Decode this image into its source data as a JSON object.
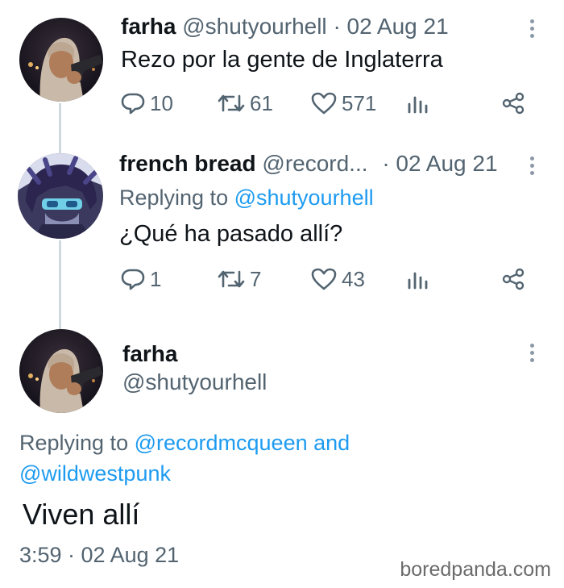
{
  "tweet1": {
    "name": "farha",
    "handle": "@shutyourhell",
    "sep": "·",
    "date": "02 Aug 21",
    "text": "Rezo por la gente de Inglaterra",
    "replies": "10",
    "retweets": "61",
    "likes": "571"
  },
  "tweet2": {
    "name": "french bread",
    "handle": "@record...",
    "sep": "·",
    "date": "02 Aug 21",
    "replying_prefix": "Replying to ",
    "replying_to": "@shutyourhell",
    "text": "¿Qué ha pasado allí?",
    "replies": "1",
    "retweets": "7",
    "likes": "43"
  },
  "tweet3": {
    "name": "farha",
    "handle": "@shutyourhell",
    "replying_prefix": "Replying to ",
    "replying_to_1": "@recordmcqueen",
    "replying_and": " and",
    "replying_to_2": "@wildwestpunk",
    "text": "Viven allí",
    "time": "3:59 · 02 Aug 21"
  },
  "watermark": "boredpanda.com",
  "colors": {
    "link": "#1d9bf0",
    "muted": "#536471",
    "text": "#0f1419",
    "thread_line": "#cfd9de"
  },
  "icons": [
    "reply-icon",
    "retweet-icon",
    "like-icon",
    "analytics-icon",
    "share-icon",
    "more-options-icon"
  ]
}
